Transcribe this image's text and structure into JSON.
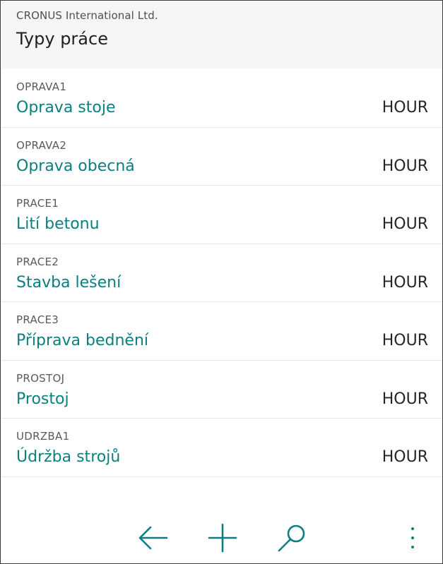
{
  "header": {
    "company": "CRONUS International Ltd.",
    "title": "Typy práce"
  },
  "rows": [
    {
      "code": "OPRAVA1",
      "description": "Oprava stoje",
      "unit": "HOUR"
    },
    {
      "code": "OPRAVA2",
      "description": "Oprava obecná",
      "unit": "HOUR"
    },
    {
      "code": "PRACE1",
      "description": "Lití betonu",
      "unit": "HOUR"
    },
    {
      "code": "PRACE2",
      "description": "Stavba lešení",
      "unit": "HOUR"
    },
    {
      "code": "PRACE3",
      "description": "Příprava bednění",
      "unit": "HOUR"
    },
    {
      "code": "PROSTOJ",
      "description": "Prostoj",
      "unit": "HOUR"
    },
    {
      "code": "UDRZBA1",
      "description": "Údržba strojů",
      "unit": "HOUR"
    }
  ],
  "actions": [
    "back-arrow-icon",
    "plus-icon",
    "search-icon",
    "more-vertical-icon"
  ],
  "colors": {
    "accent": "#0b7f80",
    "header_bg": "#f4f5f6",
    "divider": "#e6e6e6"
  }
}
